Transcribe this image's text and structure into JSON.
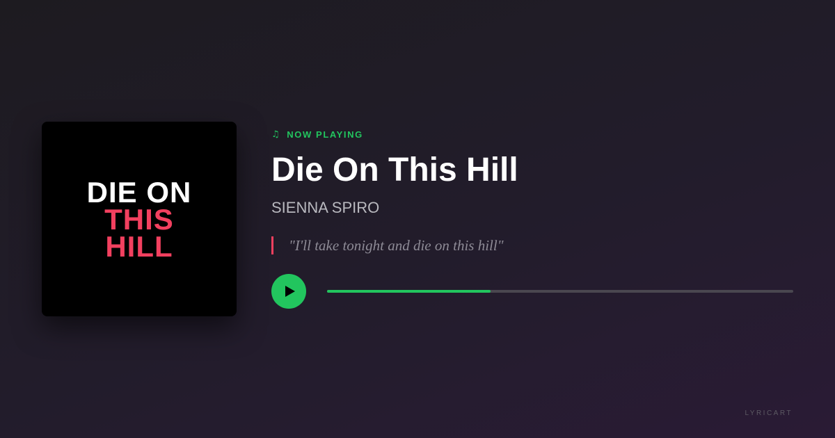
{
  "album_art": {
    "line1": "DIE ON",
    "line2": "THIS",
    "line3": "HILL"
  },
  "now_playing": {
    "icon": "music-note-icon",
    "label": "NOW PLAYING"
  },
  "song": {
    "title": "Die On This Hill",
    "artist": "SIENNA SPIRO",
    "lyric": "\"I'll take tonight and die on this hill\""
  },
  "player": {
    "play_icon": "play-icon",
    "progress_fraction": 0.35
  },
  "brand": "LYRICART",
  "colors": {
    "accent_green": "#22c55e",
    "accent_pink": "#f2405f"
  }
}
